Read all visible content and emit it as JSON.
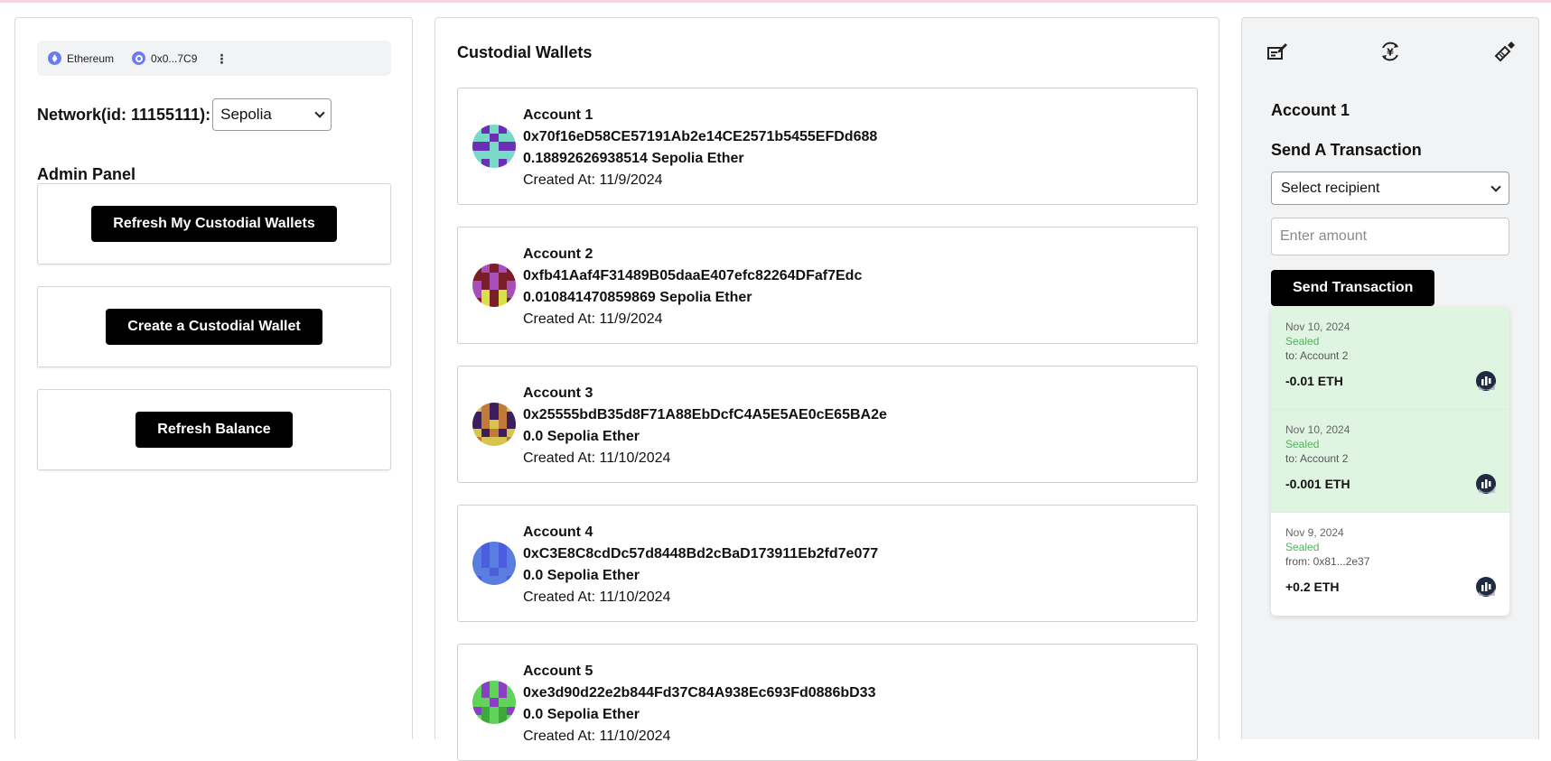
{
  "wallet_bar": {
    "network_label": "Ethereum",
    "address_short": "0x0...7C9",
    "more_glyph": "⋮"
  },
  "network": {
    "label": "Network(id: 11155111):",
    "selected": "Sepolia"
  },
  "admin": {
    "title": "Admin Panel",
    "refresh_wallets_label": "Refresh My Custodial Wallets",
    "create_wallet_label": "Create a Custodial Wallet",
    "refresh_balance_label": "Refresh Balance"
  },
  "custodial": {
    "title": "Custodial Wallets",
    "wallets": [
      {
        "name": "Account 1",
        "address": "0x70f16eD58CE57191Ab2e14CE2571b5455EFDd688",
        "balance": "0.18892626938514 Sepolia Ether",
        "created": "Created At: 11/9/2024",
        "avatar_colors": [
          "#79d9c7",
          "#6b2fb3",
          "#79d9c7",
          "#79d9c7",
          "#6b2fb3",
          "#6b2fb3",
          "#79d9c7",
          "#79d9c7",
          "#79d9c7",
          "#6b2fb3"
        ]
      },
      {
        "name": "Account 2",
        "address": "0xfb41Aaf4F31489B05daaE407efc82264DFaf7Edc",
        "balance": "0.010841470859869 Sepolia Ether",
        "created": "Created At: 11/9/2024",
        "avatar_colors": [
          "#7a1e28",
          "#a64fb8",
          "#7a1e28",
          "#7a1e28",
          "#a64fb8",
          "#7a1e28",
          "#a64fb8",
          "#d6e04a",
          "#7a1e28",
          "#d6e04a"
        ]
      },
      {
        "name": "Account 3",
        "address": "0x25555bdB35d8F71A88EbDcfC4A5E5AE0cE65BA2e",
        "balance": "0.0 Sepolia Ether",
        "created": "Created At: 11/10/2024",
        "avatar_colors": [
          "#d9c34f",
          "#c27a3b",
          "#3a1f5c",
          "#c27a3b",
          "#3a1f5c",
          "#c27a3b",
          "#d9c34f",
          "#3a1f5c",
          "#c27a3b",
          "#d9c34f"
        ]
      },
      {
        "name": "Account 4",
        "address": "0xC3E8C8cdDc57d8448Bd2cBaD173911Eb2fd7e077",
        "balance": "0.0 Sepolia Ether",
        "created": "Created At: 11/10/2024",
        "avatar_colors": [
          "#5a7de0",
          "#4b5ee0",
          "#5a7de0",
          "#4b5ee0",
          "#5a7de0",
          "#4b5ee0",
          "#5a7de0",
          "#5a7de0",
          "#4b5ee0",
          "#5a7de0"
        ]
      },
      {
        "name": "Account 5",
        "address": "0xe3d90d22e2b844Fd37C84A938Ec693Fd0886bD33",
        "balance": "0.0 Sepolia Ether",
        "created": "Created At: 11/10/2024",
        "avatar_colors": [
          "#5fd35a",
          "#8a3fc4",
          "#5fd35a",
          "#8a3fc4",
          "#5fd35a",
          "#5fd35a",
          "#8a3fc4",
          "#3fa83a",
          "#5fd35a",
          "#3fa83a"
        ]
      }
    ]
  },
  "send": {
    "account_title": "Account 1",
    "title": "Send A Transaction",
    "recipient_placeholder": "Select recipient",
    "amount_placeholder": "Enter amount",
    "button_label": "Send Transaction"
  },
  "transactions": [
    {
      "date": "Nov 10, 2024",
      "status": "Sealed",
      "party": "to: Account 2",
      "amount": "-0.01 ETH",
      "kind": "sent"
    },
    {
      "date": "Nov 10, 2024",
      "status": "Sealed",
      "party": "to: Account 2",
      "amount": "-0.001 ETH",
      "kind": "sent"
    },
    {
      "date": "Nov 9, 2024",
      "status": "Sealed",
      "party": "from: 0x81...2e37",
      "amount": "+0.2 ETH",
      "kind": "received"
    }
  ],
  "icons": {
    "tool_1": "sign-message-icon",
    "tool_2": "currency-exchange-icon",
    "tool_3": "token-sign-icon",
    "tx_logo": "chain-logo-icon"
  },
  "colors": {
    "sealed_green": "#4fb35c",
    "sent_bg": "#dff5e2",
    "button_bg": "#000000"
  }
}
